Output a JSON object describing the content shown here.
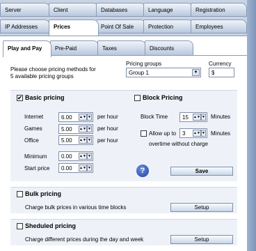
{
  "tabs_row1": [
    "Server",
    "Client",
    "Databases",
    "Language",
    "Registration"
  ],
  "tabs_row2": [
    "IP Addresses",
    "Prices",
    "Point Of Sale",
    "Protection",
    "Employees"
  ],
  "tabs_row3": [
    "Play and Pay",
    "Pre-Paid",
    "Taxes",
    "Discounts"
  ],
  "intro": {
    "line1": "Please choose pricing methods for",
    "line2": "5 available pricing groups"
  },
  "pricing_groups": {
    "label": "Pricing groups",
    "value": "Group 1"
  },
  "currency": {
    "label": "Currency",
    "value": "$"
  },
  "basic_pricing": {
    "title": "Basic pricing",
    "checked": "✔",
    "rows": [
      {
        "label": "Internet",
        "value": "6.00",
        "unit": "per hour"
      },
      {
        "label": "Games",
        "value": "5.00",
        "unit": "per hour"
      },
      {
        "label": "Office",
        "value": "5.00",
        "unit": "per hour"
      }
    ],
    "minimum": {
      "label": "Minimum",
      "value": "0.00"
    },
    "start_price": {
      "label": "Start price",
      "value": "0.00"
    }
  },
  "block_pricing": {
    "title": "Block Pricing",
    "block_time": {
      "label": "Block Time",
      "value": "15",
      "unit": "Minutes"
    },
    "allow": {
      "label": "Allow up to",
      "value": "3",
      "unit": "Minutes",
      "line2": "overtime without charge"
    }
  },
  "save_label": "Save",
  "help_glyph": "?",
  "bulk": {
    "title": "Bulk pricing",
    "desc": "Charge bulk prices in various time blocks",
    "button": "Setup"
  },
  "scheduled": {
    "title": "Sheduled pricing",
    "desc": "Charge different prices during the day and week",
    "button": "Setup"
  }
}
